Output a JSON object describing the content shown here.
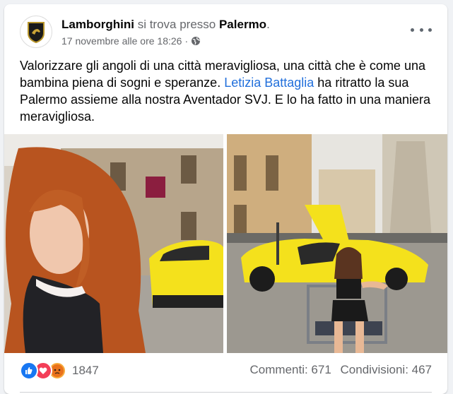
{
  "post": {
    "author": "Lamborghini",
    "location_prefix": "si trova presso",
    "location": "Palermo",
    "location_suffix": ".",
    "timestamp": "17 novembre alle ore 18:26",
    "separator": "·",
    "privacy_icon": "globe-icon",
    "text_part1": "Valorizzare gli angoli di una città meravigliosa, una città che è come una bambina piena di sogni e speranze. ",
    "tag_name": "Letizia Battaglia",
    "text_part2": " ha ritratto la sua Palermo assieme alla nostra Aventador SVJ. E lo ha fatto in una maniera meravigliosa."
  },
  "reactions": {
    "icons": [
      "like-icon",
      "love-icon",
      "angry-icon"
    ],
    "count": "1847"
  },
  "stats": {
    "comments": "Commenti: 671",
    "shares": "Condivisioni: 467"
  },
  "colors": {
    "link": "#216fdb",
    "like": "#1877f2",
    "love": "#f33e58",
    "angry": "#f7a93b",
    "car": "#f4e11c"
  }
}
